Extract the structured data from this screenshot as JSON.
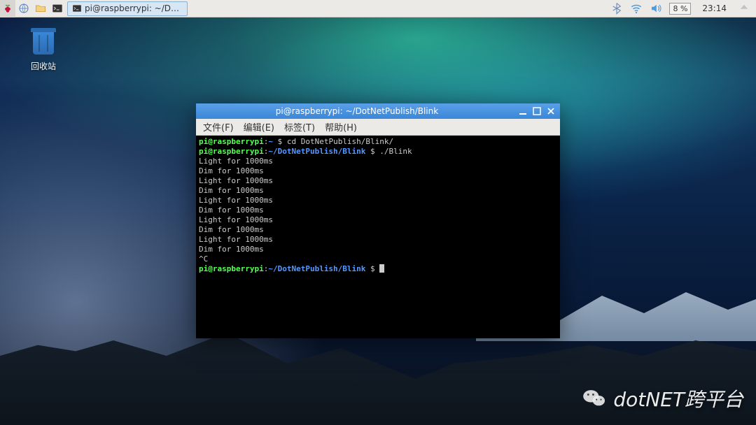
{
  "taskbar": {
    "window_title": "pi@raspberrypi: ~/Do...",
    "cpu": "8 %",
    "clock": "23:14"
  },
  "desktop": {
    "trash_label": "回收站"
  },
  "terminal": {
    "title": "pi@raspberrypi: ~/DotNetPublish/Blink",
    "menus": {
      "file": "文件(F)",
      "edit": "编辑(E)",
      "tabs": "标签(T)",
      "help": "帮助(H)"
    },
    "prompt1_user": "pi@raspberrypi",
    "prompt1_path": "~",
    "prompt1_sep": ":",
    "prompt1_dollar": " $ ",
    "cmd1": "cd DotNetPublish/Blink/",
    "prompt2_user": "pi@raspberrypi",
    "prompt2_path": "~/DotNetPublish/Blink",
    "cmd2": "./Blink",
    "output": [
      "Light for 1000ms",
      "Dim for 1000ms",
      "Light for 1000ms",
      "Dim for 1000ms",
      "Light for 1000ms",
      "Dim for 1000ms",
      "Light for 1000ms",
      "Dim for 1000ms",
      "Light for 1000ms",
      "Dim for 1000ms",
      "^C"
    ],
    "prompt3_user": "pi@raspberrypi",
    "prompt3_path": "~/DotNetPublish/Blink"
  },
  "watermark": {
    "text": "dotNET跨平台"
  }
}
